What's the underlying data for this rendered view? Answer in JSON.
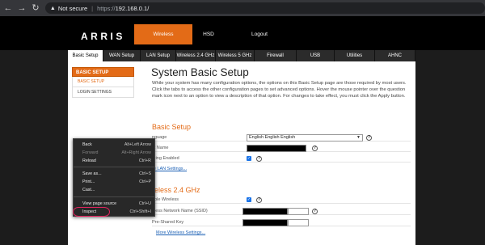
{
  "browser": {
    "back": "←",
    "forward": "→",
    "reload": "↻",
    "warning_icon": "▲",
    "security_label": "Not secure",
    "url_protocol": "https://",
    "url_host": "192.168.0.1/"
  },
  "header": {
    "logo": "ARRIS",
    "nav": [
      "Wireless",
      "HSD",
      "Logout"
    ]
  },
  "tabs": [
    "Basic Setup",
    "WAN Setup",
    "LAN Setup",
    "Wireless 2.4 GHz",
    "Wireless 5 GHz",
    "Firewall",
    "USB",
    "Utilities",
    "AHNC"
  ],
  "sidebar": {
    "header": "BASIC SETUP",
    "items": [
      "BASIC SETUP",
      "LOGIN SETTINGS"
    ]
  },
  "main": {
    "title": "System Basic Setup",
    "description": "While your system has many configuration options, the options on this Basic Setup page are those required by most users. Click the tabs to access the other configuration pages to set advanced options. Hover the mouse pointer over the question mark icon next to an option to view a description of that option. For changes to take effect, you must click the Apply button.",
    "basic": {
      "heading": "Basic Setup",
      "language_label": "nguage",
      "language_value": "English English English",
      "host_label": "st Name",
      "routing_label": "uting Enabled",
      "lan_link": "re LAN Settings..."
    },
    "wireless": {
      "heading": "reless 2.4 GHz",
      "enable_label": "able Wireless",
      "ssid_label": "eless Network Name (SSID)",
      "psk_label": "Pre-Shared Key",
      "more_link": "More Wireless Settings..."
    }
  },
  "context_menu": {
    "items": [
      {
        "label": "Back",
        "shortcut": "Alt+Left Arrow"
      },
      {
        "label": "Forward",
        "shortcut": "Alt+Right Arrow"
      },
      {
        "label": "Reload",
        "shortcut": "Ctrl+R"
      },
      {
        "label": "Save as...",
        "shortcut": "Ctrl+S"
      },
      {
        "label": "Print...",
        "shortcut": "Ctrl+P"
      },
      {
        "label": "Cast...",
        "shortcut": ""
      },
      {
        "label": "View page source",
        "shortcut": "Ctrl+U"
      },
      {
        "label": "Inspect",
        "shortcut": "Ctrl+Shift+I"
      }
    ]
  },
  "colors": {
    "accent": "#e36b17",
    "header_bg": "#000000",
    "annotation": "#e0245e"
  }
}
